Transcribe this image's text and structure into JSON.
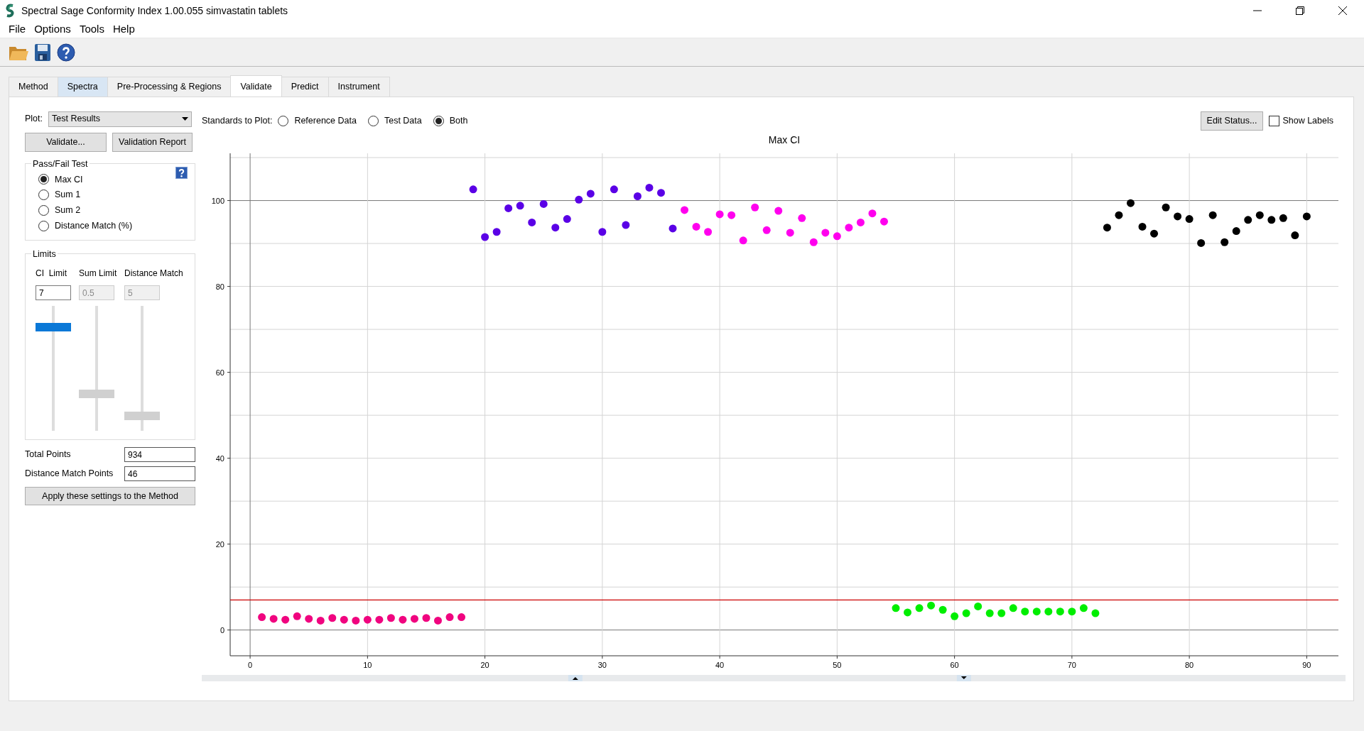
{
  "window": {
    "title": "Spectral Sage Conformity Index 1.00.055 simvastatin tablets"
  },
  "menu": [
    "File",
    "Options",
    "Tools",
    "Help"
  ],
  "tabs": [
    {
      "label": "Method",
      "selected": false,
      "hovered": false
    },
    {
      "label": "Spectra",
      "selected": false,
      "hovered": true
    },
    {
      "label": "Pre-Processing & Regions",
      "selected": false,
      "hovered": false
    },
    {
      "label": "Validate",
      "selected": true,
      "hovered": false
    },
    {
      "label": "Predict",
      "selected": false,
      "hovered": false
    },
    {
      "label": "Instrument",
      "selected": false,
      "hovered": false
    }
  ],
  "plot_selector": {
    "label": "Plot:",
    "value": "Test Results"
  },
  "action_buttons": [
    "Validate...",
    "Validation Report"
  ],
  "standards": {
    "label": "Standards to Plot:",
    "options": [
      {
        "label": "Reference Data",
        "selected": false
      },
      {
        "label": "Test Data",
        "selected": false
      },
      {
        "label": "Both",
        "selected": true
      }
    ]
  },
  "pass_fail": {
    "title": "Pass/Fail Test",
    "options": [
      {
        "label": "Max CI",
        "selected": true
      },
      {
        "label": "Sum 1",
        "selected": false
      },
      {
        "label": "Sum 2",
        "selected": false
      },
      {
        "label": "Distance Match (%)",
        "selected": false
      }
    ]
  },
  "limits": {
    "title": "Limits",
    "columns": [
      {
        "label": "CI  Limit",
        "value": "7",
        "disabled": false,
        "level": 0.85
      },
      {
        "label": "Sum Limit",
        "value": "0.5",
        "disabled": true,
        "level": 0.28
      },
      {
        "label": "Distance Match",
        "value": "5",
        "disabled": true,
        "level": 0.09
      }
    ]
  },
  "totals": [
    {
      "label": "Total Points",
      "value": "934"
    },
    {
      "label": "Distance Match Points",
      "value": "46"
    }
  ],
  "apply_button": "Apply these settings to the Method",
  "edit_status_button": "Edit Status...",
  "show_labels": {
    "label": "Show Labels",
    "checked": false
  },
  "chart": {
    "chart_data": {
      "type": "scatter",
      "title": "Max CI",
      "x": [
        1,
        2,
        3,
        4,
        5,
        6,
        7,
        8,
        9,
        10,
        11,
        12,
        13,
        14,
        15,
        16,
        17,
        18,
        19,
        20,
        21,
        22,
        23,
        24,
        25,
        26,
        27,
        28,
        29,
        30,
        31,
        32,
        33,
        34,
        35,
        36,
        37,
        38,
        39,
        40,
        41,
        42,
        43,
        44,
        45,
        46,
        47,
        48,
        49,
        50,
        51,
        52,
        53,
        54,
        55,
        56,
        57,
        58,
        59,
        60,
        61,
        62,
        63,
        64,
        65,
        66,
        67,
        68,
        69,
        70,
        71,
        72,
        73,
        74,
        75,
        76,
        77,
        78,
        79,
        80,
        81,
        82,
        83,
        84,
        85,
        86,
        87,
        88,
        89,
        90
      ],
      "series": [
        {
          "color": "#f0047f",
          "values": [
            3.0,
            2.6,
            2.4,
            3.2,
            2.6,
            2.2,
            2.8,
            2.4,
            2.2,
            2.4,
            2.4,
            2.8,
            2.4,
            2.6,
            2.8,
            2.2,
            3.0,
            3.0,
            null,
            null,
            null,
            null,
            null,
            null,
            null,
            null,
            null,
            null,
            null,
            null,
            null,
            null,
            null,
            null,
            null,
            null,
            null,
            null,
            null,
            null,
            null,
            null,
            null,
            null,
            null,
            null,
            null,
            null,
            null,
            null,
            null,
            null,
            null,
            null,
            null,
            null,
            null,
            null,
            null,
            null,
            null,
            null,
            null,
            null,
            null,
            null,
            null,
            null,
            null,
            null,
            null,
            null,
            null,
            null,
            null,
            null,
            null,
            null,
            null,
            null,
            null,
            null,
            null,
            null,
            null,
            null,
            null,
            null,
            null,
            null
          ]
        },
        {
          "color": "#5a00e6",
          "values": [
            null,
            null,
            null,
            null,
            null,
            null,
            null,
            null,
            null,
            null,
            null,
            null,
            null,
            null,
            null,
            null,
            null,
            null,
            102.6,
            91.5,
            92.7,
            98.2,
            98.8,
            94.9,
            99.2,
            93.7,
            95.7,
            100.2,
            101.6,
            92.7,
            102.6,
            94.3,
            101.0,
            103.0,
            101.8,
            93.5,
            null,
            null,
            null,
            null,
            null,
            null,
            null,
            null,
            null,
            null,
            null,
            null,
            null,
            null,
            null,
            null,
            null,
            null,
            null,
            null,
            null,
            null,
            null,
            null,
            null,
            null,
            null,
            null,
            null,
            null,
            null,
            null,
            null,
            null,
            null,
            null,
            null,
            null,
            null,
            null,
            null,
            null,
            null,
            null,
            null,
            null,
            null,
            null,
            null,
            null,
            null,
            null,
            null,
            null
          ]
        },
        {
          "color": "#ff00ee",
          "values": [
            null,
            null,
            null,
            null,
            null,
            null,
            null,
            null,
            null,
            null,
            null,
            null,
            null,
            null,
            null,
            null,
            null,
            null,
            null,
            null,
            null,
            null,
            null,
            null,
            null,
            null,
            null,
            null,
            null,
            null,
            null,
            null,
            null,
            null,
            null,
            null,
            97.8,
            93.9,
            92.7,
            96.8,
            96.6,
            90.7,
            98.4,
            93.1,
            97.6,
            92.5,
            95.9,
            90.3,
            92.5,
            91.7,
            93.7,
            94.9,
            97.0,
            95.1,
            null,
            null,
            null,
            null,
            null,
            null,
            null,
            null,
            null,
            null,
            null,
            null,
            null,
            null,
            null,
            null,
            null,
            null,
            null,
            null,
            null,
            null,
            null,
            null,
            null,
            null,
            null,
            null,
            null,
            null,
            null,
            null,
            null,
            null,
            null,
            null
          ]
        },
        {
          "color": "#00ee00",
          "values": [
            null,
            null,
            null,
            null,
            null,
            null,
            null,
            null,
            null,
            null,
            null,
            null,
            null,
            null,
            null,
            null,
            null,
            null,
            null,
            null,
            null,
            null,
            null,
            null,
            null,
            null,
            null,
            null,
            null,
            null,
            null,
            null,
            null,
            null,
            null,
            null,
            null,
            null,
            null,
            null,
            null,
            null,
            null,
            null,
            null,
            null,
            null,
            null,
            null,
            null,
            null,
            null,
            null,
            null,
            5.1,
            4.1,
            5.1,
            5.7,
            4.7,
            3.2,
            3.9,
            5.5,
            3.9,
            3.9,
            5.1,
            4.3,
            4.3,
            4.3,
            4.3,
            4.3,
            5.1,
            3.9,
            null,
            null,
            null,
            null,
            null,
            null,
            null,
            null,
            null,
            null,
            null,
            null,
            null,
            null,
            null,
            null,
            null,
            null
          ]
        },
        {
          "color": "#000000",
          "values": [
            null,
            null,
            null,
            null,
            null,
            null,
            null,
            null,
            null,
            null,
            null,
            null,
            null,
            null,
            null,
            null,
            null,
            null,
            null,
            null,
            null,
            null,
            null,
            null,
            null,
            null,
            null,
            null,
            null,
            null,
            null,
            null,
            null,
            null,
            null,
            null,
            null,
            null,
            null,
            null,
            null,
            null,
            null,
            null,
            null,
            null,
            null,
            null,
            null,
            null,
            null,
            null,
            null,
            null,
            null,
            null,
            null,
            null,
            null,
            null,
            null,
            null,
            null,
            null,
            null,
            null,
            null,
            null,
            null,
            null,
            null,
            null,
            93.7,
            96.6,
            99.4,
            93.9,
            92.3,
            98.4,
            96.3,
            95.7,
            90.1,
            96.6,
            90.3,
            92.9,
            95.5,
            96.6,
            95.5,
            95.9,
            91.9,
            96.3
          ]
        }
      ],
      "xlim": [
        -1.7,
        92.7
      ],
      "ylim": [
        -6,
        111
      ],
      "xticks": [
        0,
        10,
        20,
        30,
        40,
        50,
        60,
        70,
        80,
        90
      ],
      "yticks": [
        0,
        20,
        40,
        60,
        80,
        100
      ],
      "grid": true,
      "ref_lines": [
        {
          "axis": "y",
          "value": 7
        }
      ]
    }
  }
}
